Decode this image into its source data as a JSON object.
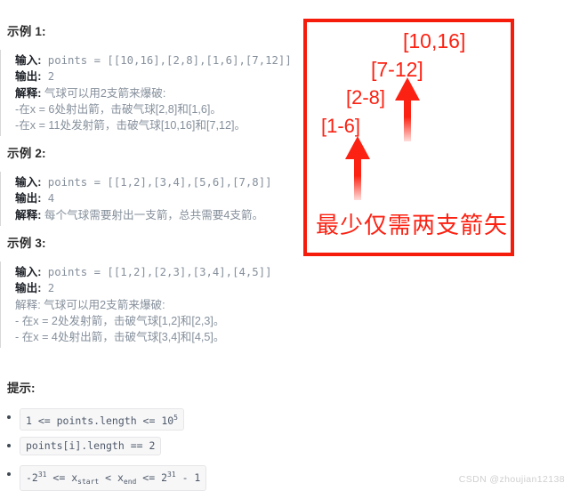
{
  "examples": [
    {
      "heading": "示例 1:",
      "lines": [
        {
          "label": "输入:",
          "bold": true,
          "text": " points = [[10,16],[2,8],[1,6],[7,12]]",
          "mono": true
        },
        {
          "label": "输出:",
          "bold": true,
          "text": " 2",
          "mono": true
        },
        {
          "label": "解释:",
          "bold": true,
          "text": " 气球可以用2支箭来爆破:",
          "mono": false
        },
        {
          "label": "",
          "bold": false,
          "text": "-在x = 6处射出箭，击破气球[2,8]和[1,6]。",
          "mono": false
        },
        {
          "label": "",
          "bold": false,
          "text": "-在x = 11处发射箭，击破气球[10,16]和[7,12]。",
          "mono": false
        }
      ]
    },
    {
      "heading": "示例 2:",
      "lines": [
        {
          "label": "输入:",
          "bold": true,
          "text": " points = [[1,2],[3,4],[5,6],[7,8]]",
          "mono": true
        },
        {
          "label": "输出:",
          "bold": true,
          "text": " 4",
          "mono": true
        },
        {
          "label": "解释:",
          "bold": true,
          "text": " 每个气球需要射出一支箭，总共需要4支箭。",
          "mono": false
        }
      ]
    },
    {
      "heading": "示例 3:",
      "lines": [
        {
          "label": "输入:",
          "bold": true,
          "text": " points = [[1,2],[2,3],[3,4],[4,5]]",
          "mono": true
        },
        {
          "label": "输出:",
          "bold": true,
          "text": " 2",
          "mono": true
        },
        {
          "label": "解释:",
          "bold": false,
          "text": " 气球可以用2支箭来爆破:",
          "mono": false
        },
        {
          "label": "",
          "bold": false,
          "text": "- 在x = 2处发射箭，击破气球[1,2]和[2,3]。",
          "mono": false
        },
        {
          "label": "",
          "bold": false,
          "text": "- 在x = 4处射出箭，击破气球[3,4]和[4,5]。",
          "mono": false
        }
      ]
    }
  ],
  "hints": {
    "heading": "提示:",
    "items": [
      {
        "html": "1 <= points.length <= 10<sup>5</sup>"
      },
      {
        "html": "points[i].length == 2"
      },
      {
        "html": "-2<sup>31</sup> <= x<sub>start</sub> < x<sub>end</sub> <= 2<sup>31</sup> - 1"
      }
    ]
  },
  "annotation": {
    "color": "#fb2213",
    "border_color": "#f51c0c",
    "labels": [
      {
        "text": "[10,16]"
      },
      {
        "text": "[7-12]"
      },
      {
        "text": "[2-8]"
      },
      {
        "text": "[1-6]"
      }
    ],
    "caption": "最少仅需两支箭矢",
    "arrows": [
      {
        "name": "arrow-right-group"
      },
      {
        "name": "arrow-left-group"
      }
    ]
  },
  "watermark": "CSDN @zhoujian12138"
}
